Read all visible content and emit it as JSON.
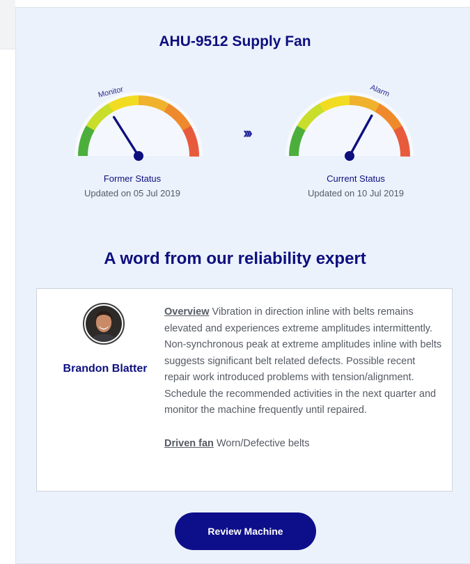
{
  "header": {
    "title": "AHU-9512 Supply Fan"
  },
  "status_transition_icon": "triple-chevron-right-icon",
  "gauges": [
    {
      "zone_label": "Monitor",
      "level": 0.32,
      "caption": "Former Status",
      "updated": "Updated on 05 Jul 2019"
    },
    {
      "zone_label": "Alarm",
      "level": 0.66,
      "caption": "Current Status",
      "updated": "Updated on 10 Jul 2019"
    }
  ],
  "gauge_colors": [
    "#4caf3c",
    "#c8de2a",
    "#f1dc22",
    "#f0b22c",
    "#ef8a2c",
    "#e85a3c"
  ],
  "expert": {
    "heading": "A word from our reliability expert",
    "name": "Brandon Blatter",
    "avatar_icon": "person-avatar-icon",
    "overview_label": "Overview",
    "overview_text": "Vibration in direction inline with belts remains elevated and experiences extreme amplitudes intermittently. Non-synchronous peak at extreme amplitudes inline with belts suggests significant belt related defects. Possible recent repair work introduced problems with tension/alignment. Schedule the recommended activities in the next quarter and monitor the machine frequently until repaired.",
    "component_label": "Driven fan",
    "component_text": "Worn/Defective belts"
  },
  "actions": {
    "review_label": "Review Machine"
  },
  "colors": {
    "brand": "#0d0f7e",
    "button": "#0d0f8a",
    "card_bg": "#ecf2fc"
  }
}
